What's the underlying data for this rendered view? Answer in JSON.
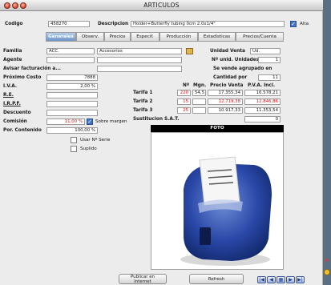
{
  "window": {
    "title": "ARTICULOS"
  },
  "header": {
    "codigo_label": "Codigo",
    "codigo_value": "458270",
    "descripcion_label": "Descripcion",
    "descripcion_value": "Holder+Butterfly tubing 0cm 2.0x1/4\"",
    "alta_label": "Alta"
  },
  "tabs": [
    "Generales",
    "Observ.",
    "Precios",
    "Especif.",
    "Producción",
    "Estadísticas",
    "Precios/Cuenta"
  ],
  "left": {
    "familia_label": "Familia",
    "familia_code": "ACC.",
    "familia_value": "Accesorios",
    "agente_label": "Agente",
    "avisar_label": "Avisar facturación a...",
    "proximo_costo_label": "Próximo Costo",
    "proximo_costo_value": "7888",
    "iva_label": "I.V.A.",
    "iva_value": "2,00 %",
    "re_label": "R.E.",
    "irpf_label": "I.R.P.F.",
    "descuento_label": "Descuento",
    "comision_label": "Comisión",
    "comision_value": "11,00 %",
    "sobre_margen_label": "Sobre margen",
    "por_contenido_label": "Por. Contenido",
    "por_contenido_value": "100,00 %",
    "check1_label": "Usar Nº Serie",
    "check2_label": "Suplido"
  },
  "right": {
    "unidad_venta_label": "Unidad Venta",
    "unidad_venta_value": "Ud.",
    "numero_unidades_label": "Nº unid. Unidades",
    "numero_unidades_value": "1",
    "se_vende_label": "Se vende agrupado en",
    "cantidad_por_label": "Cantidad por",
    "cantidad_por_value": "11",
    "col_num": "Nº",
    "col_mgn": "Mgn.",
    "col_pv": "Precio Venta",
    "col_pvi": "P.V.A. Incl.",
    "tarifas": [
      {
        "label": "Tarifa 1",
        "num": "220",
        "mgn": "54,5",
        "pv": "17.355,34",
        "pvi": "16.578,21"
      },
      {
        "label": "Tarifa 2",
        "num": "15",
        "mgn": "",
        "pv": "12.719,38",
        "pvi": "12.846,86"
      },
      {
        "label": "Tarifa 3",
        "num": "25",
        "mgn": "",
        "pv": "10.917,33",
        "pvi": "11.353,54"
      }
    ],
    "sustitucion_label": "Sustitucion S.A.T.",
    "sustitucion_value": "0",
    "foto_label": "FOTO"
  },
  "buttons": {
    "publicar_line1": "Publicar en",
    "publicar_line2": "Internet",
    "refresh": "Refresh"
  },
  "colors": {
    "accent": "#4274c8",
    "red": "#d11111",
    "foto_header": "#000000"
  }
}
